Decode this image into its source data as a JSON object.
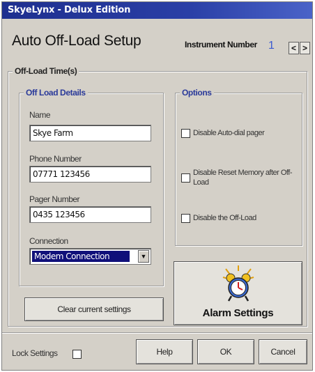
{
  "window": {
    "title": "SkyeLynx - Delux Edition"
  },
  "header": {
    "heading": "Auto Off-Load Setup",
    "instrument_label": "Instrument Number",
    "instrument_value": "1",
    "prev_label": "<",
    "next_label": ">"
  },
  "offload_group": {
    "legend": "Off-Load Time(s)"
  },
  "details": {
    "legend": "Off Load Details",
    "name_label": "Name",
    "name_value": "Skye Farm",
    "phone_label": "Phone Number",
    "phone_value": "07771 123456",
    "pager_label": "Pager Number",
    "pager_value": "0435 123456",
    "connection_label": "Connection",
    "connection_value": "Modem Connection",
    "dropdown_glyph": "▼"
  },
  "options": {
    "legend": "Options",
    "items": [
      {
        "label": "Disable Auto-dial pager",
        "checked": false
      },
      {
        "label": "Disable Reset Memory after Off-Load",
        "checked": false
      },
      {
        "label": "Disable the Off-Load",
        "checked": false
      }
    ]
  },
  "buttons": {
    "clear_label": "Clear current settings",
    "alarm_label": "Alarm Settings",
    "help_label": "Help",
    "ok_label": "OK",
    "cancel_label": "Cancel"
  },
  "footer": {
    "lock_label": "Lock Settings",
    "lock_checked": false
  },
  "colors": {
    "titlebar": "#1e2f8f",
    "window_bg": "#d4d0c8",
    "selection": "#10107a",
    "instrument_value": "#3a5ad0"
  }
}
